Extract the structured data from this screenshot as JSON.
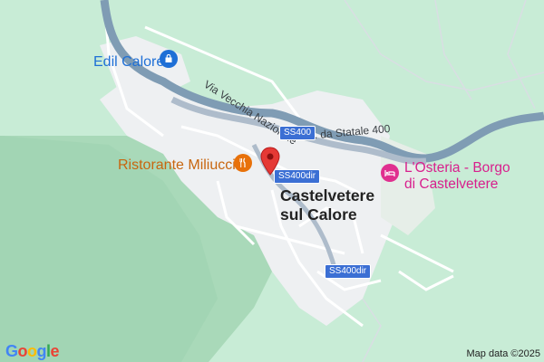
{
  "map": {
    "pois": {
      "edil_calore": {
        "label": "Edil Calore",
        "icon": "shopping-bag-icon",
        "color": "#1e6fd6"
      },
      "ristorante": {
        "label": "Ristorante Miliuccio",
        "icon": "restaurant-icon",
        "color": "#e8710a"
      },
      "osteria": {
        "line1": "L'Osteria - Borgo",
        "line2": "di Castelvetere",
        "icon": "hotel-icon",
        "color": "#e0308f"
      }
    },
    "town": {
      "line1": "Castelvetere",
      "line2": "sul Calore"
    },
    "roads": {
      "via_vecchia": "Via Vecchia Nazionale",
      "sp_statale": "S. da Statale 400"
    },
    "shields": {
      "ss400": "SS400",
      "ss400dir_top": "SS400dir",
      "ss400dir_bottom": "SS400dir"
    },
    "marker": {
      "icon": "location-pin-icon",
      "color": "#e53935"
    },
    "footer": {
      "logo": "Google",
      "attribution": "Map data ©2025"
    }
  }
}
